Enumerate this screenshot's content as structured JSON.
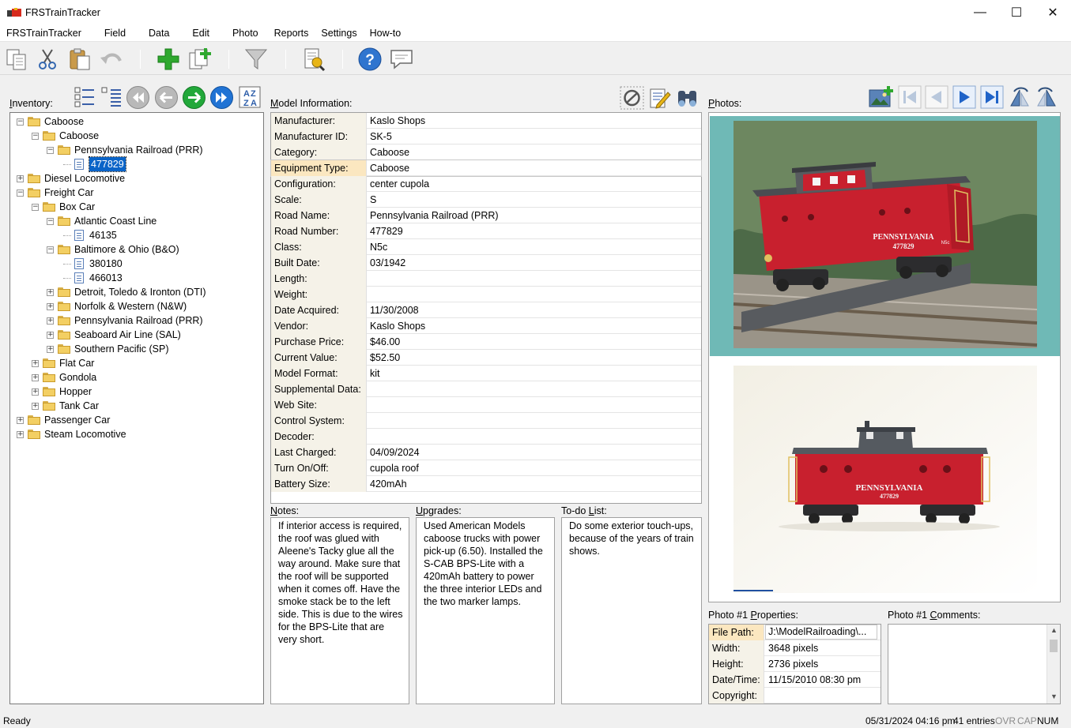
{
  "app": {
    "title": "FRSTrainTracker"
  },
  "window_controls": {
    "minimize": "—",
    "maximize": "☐",
    "close": "✕"
  },
  "menu": [
    "FRSTrainTracker",
    "Field",
    "Data",
    "Edit",
    "Photo",
    "Reports",
    "Settings",
    "How-to"
  ],
  "toolbar": {
    "icons": [
      "copy-icon",
      "cut-icon",
      "paste-icon",
      "undo-icon",
      "add-icon",
      "duplicate-icon",
      "filter-icon",
      "report-icon",
      "help-icon",
      "comment-icon"
    ]
  },
  "inventory": {
    "label_prefix": "",
    "label_underlined": "I",
    "label_rest": "nventory:",
    "nav_icons": [
      "expand-all-icon",
      "collapse-all-icon",
      "first-icon",
      "previous-icon",
      "next-icon",
      "last-icon",
      "sort-az-icon"
    ],
    "tree": [
      {
        "label": "Caboose",
        "level": 0,
        "type": "folder",
        "exp": "−"
      },
      {
        "label": "Caboose",
        "level": 1,
        "type": "folder",
        "exp": "−"
      },
      {
        "label": "Pennsylvania Railroad (PRR)",
        "level": 2,
        "type": "folder",
        "exp": "−"
      },
      {
        "label": "477829",
        "level": 3,
        "type": "doc",
        "selected": true
      },
      {
        "label": "Diesel Locomotive",
        "level": 0,
        "type": "folder",
        "exp": "+"
      },
      {
        "label": "Freight Car",
        "level": 0,
        "type": "folder",
        "exp": "−"
      },
      {
        "label": "Box Car",
        "level": 1,
        "type": "folder",
        "exp": "−"
      },
      {
        "label": "Atlantic Coast Line",
        "level": 2,
        "type": "folder",
        "exp": "−"
      },
      {
        "label": "46135",
        "level": 3,
        "type": "doc"
      },
      {
        "label": "Baltimore & Ohio (B&O)",
        "level": 2,
        "type": "folder",
        "exp": "−"
      },
      {
        "label": "380180",
        "level": 3,
        "type": "doc"
      },
      {
        "label": "466013",
        "level": 3,
        "type": "doc"
      },
      {
        "label": "Detroit, Toledo & Ironton (DTI)",
        "level": 2,
        "type": "folder",
        "exp": "+"
      },
      {
        "label": "Norfolk & Western (N&W)",
        "level": 2,
        "type": "folder",
        "exp": "+"
      },
      {
        "label": "Pennsylvania Railroad (PRR)",
        "level": 2,
        "type": "folder",
        "exp": "+"
      },
      {
        "label": "Seaboard Air Line (SAL)",
        "level": 2,
        "type": "folder",
        "exp": "+"
      },
      {
        "label": "Southern Pacific (SP)",
        "level": 2,
        "type": "folder",
        "exp": "+"
      },
      {
        "label": "Flat Car",
        "level": 1,
        "type": "folder",
        "exp": "+"
      },
      {
        "label": "Gondola",
        "level": 1,
        "type": "folder",
        "exp": "+"
      },
      {
        "label": "Hopper",
        "level": 1,
        "type": "folder",
        "exp": "+"
      },
      {
        "label": "Tank Car",
        "level": 1,
        "type": "folder",
        "exp": "+"
      },
      {
        "label": "Passenger Car",
        "level": 0,
        "type": "folder",
        "exp": "+"
      },
      {
        "label": "Steam Locomotive",
        "level": 0,
        "type": "folder",
        "exp": "+"
      }
    ]
  },
  "model": {
    "label_underlined": "M",
    "label_rest": "odel Information:",
    "tool_icons": [
      "clear-icon",
      "edit-icon",
      "find-icon"
    ],
    "rows": [
      {
        "key": "Manufacturer:",
        "value": "Kaslo Shops"
      },
      {
        "key": "Manufacturer ID:",
        "value": "SK-5"
      },
      {
        "key": "Category:",
        "value": "Caboose"
      },
      {
        "key": "Equipment Type:",
        "value": "Caboose",
        "selected": true
      },
      {
        "key": "Configuration:",
        "value": "center cupola"
      },
      {
        "key": "Scale:",
        "value": "S"
      },
      {
        "key": "Road Name:",
        "value": "Pennsylvania Railroad (PRR)"
      },
      {
        "key": "Road Number:",
        "value": "477829"
      },
      {
        "key": "Class:",
        "value": "N5c"
      },
      {
        "key": "Built Date:",
        "value": "03/1942"
      },
      {
        "key": "Length:",
        "value": ""
      },
      {
        "key": "Weight:",
        "value": ""
      },
      {
        "key": "Date Acquired:",
        "value": "11/30/2008"
      },
      {
        "key": "Vendor:",
        "value": "Kaslo Shops"
      },
      {
        "key": "Purchase Price:",
        "value": "$46.00"
      },
      {
        "key": "Current Value:",
        "value": "$52.50"
      },
      {
        "key": "Model Format:",
        "value": "kit"
      },
      {
        "key": "Supplemental Data:",
        "value": ""
      },
      {
        "key": "Web Site:",
        "value": ""
      },
      {
        "key": "Control System:",
        "value": ""
      },
      {
        "key": "Decoder:",
        "value": ""
      },
      {
        "key": "Last Charged:",
        "value": "04/09/2024"
      },
      {
        "key": "Turn On/Off:",
        "value": "cupola roof"
      },
      {
        "key": "Battery Size:",
        "value": "420mAh"
      }
    ]
  },
  "notes": {
    "label_underlined": "N",
    "label_rest": "otes:",
    "text": "If interior access is required, the roof was glued with Aleene's Tacky glue all the way around. Make sure that the roof will be supported when it comes off. Have the smoke stack be to the left side. This is due to the wires for the BPS-Lite that are very short."
  },
  "upgrades": {
    "label_underlined": "U",
    "label_rest": "pgrades:",
    "text": "Used American Models caboose trucks with power pick-up (6.50). Installed the S-CAB BPS-Lite with a 420mAh battery to power the three interior LEDs and the two marker lamps."
  },
  "todo": {
    "label_prefix": "To-do ",
    "label_underlined": "L",
    "label_rest": "ist:",
    "text": "Do some exterior touch-ups, because of the years of train shows."
  },
  "photos": {
    "label_underlined": "P",
    "label_rest": "hotos:",
    "tool_icons": [
      "add-photo-icon",
      "first-photo-icon",
      "previous-photo-icon",
      "next-photo-icon",
      "last-photo-icon",
      "rotate-left-icon",
      "rotate-right-icon"
    ],
    "photo1": {
      "car_lettering": "PENNSYLVANIA",
      "car_number": "477829",
      "car_class": "N5c"
    },
    "photo2": {
      "car_lettering": "PENNSYLVANIA",
      "car_number": "477829"
    }
  },
  "photo_props": {
    "label_prefix": "Photo #1 ",
    "label_underlined": "P",
    "label_rest": "roperties:",
    "rows": [
      {
        "key": "File Path:",
        "value": "J:\\ModelRailroading\\...",
        "selected": true
      },
      {
        "key": "Width:",
        "value": "3648 pixels"
      },
      {
        "key": "Height:",
        "value": "2736 pixels"
      },
      {
        "key": "Date/Time:",
        "value": "11/15/2010 08:30 pm"
      },
      {
        "key": "Copyright:",
        "value": ""
      }
    ]
  },
  "photo_comments": {
    "label_prefix": "Photo #1 ",
    "label_underlined": "C",
    "label_rest": "omments:",
    "text": ""
  },
  "status": {
    "left": "Ready",
    "datetime": "05/31/2024 04:16 pm",
    "entries": "41 entries",
    "ovr": "OVR",
    "cap": "CAP",
    "num": "NUM"
  },
  "colors": {
    "selection": "#0a64c8",
    "photo_bg": "#6fb9b6",
    "caboose_red": "#c8202e",
    "key_bg": "#f5f2e8"
  }
}
